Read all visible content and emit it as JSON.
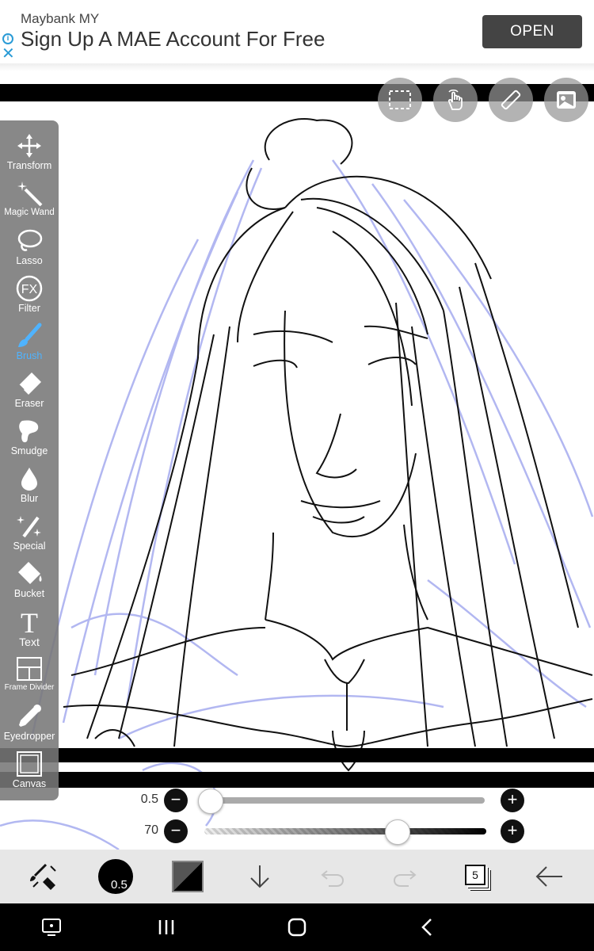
{
  "ad": {
    "sponsor": "Maybank MY",
    "title": "Sign Up A MAE Account For Free",
    "cta": "OPEN",
    "info_icon": "info-icon",
    "close_icon": "close-icon"
  },
  "canvas_tools": [
    {
      "name": "selection-icon"
    },
    {
      "name": "touch-icon"
    },
    {
      "name": "ruler-icon"
    },
    {
      "name": "material-icon"
    }
  ],
  "tools": [
    {
      "id": "transform",
      "label": "Transform",
      "icon": "move-icon"
    },
    {
      "id": "magic-wand",
      "label": "Magic Wand",
      "icon": "magic-wand-icon"
    },
    {
      "id": "lasso",
      "label": "Lasso",
      "icon": "lasso-icon"
    },
    {
      "id": "filter",
      "label": "Filter",
      "icon": "fx-icon"
    },
    {
      "id": "brush",
      "label": "Brush",
      "icon": "brush-icon"
    },
    {
      "id": "eraser",
      "label": "Eraser",
      "icon": "eraser-icon"
    },
    {
      "id": "smudge",
      "label": "Smudge",
      "icon": "smudge-icon"
    },
    {
      "id": "blur",
      "label": "Blur",
      "icon": "drop-icon"
    },
    {
      "id": "special",
      "label": "Special",
      "icon": "sparkle-icon"
    },
    {
      "id": "bucket",
      "label": "Bucket",
      "icon": "bucket-icon"
    },
    {
      "id": "text",
      "label": "Text",
      "icon": "text-icon"
    },
    {
      "id": "frame-divider",
      "label": "Frame Divider",
      "icon": "frame-divider-icon"
    },
    {
      "id": "eyedropper",
      "label": "Eyedropper",
      "icon": "eyedropper-icon"
    },
    {
      "id": "canvas",
      "label": "Canvas",
      "icon": "canvas-icon"
    }
  ],
  "active_tool": "Brush",
  "accent_color": "#4fb3ff",
  "sliders": {
    "size": {
      "value_label": "0.5",
      "minus": "−",
      "plus": "+"
    },
    "opacity": {
      "value_label": "70",
      "minus": "−",
      "plus": "+"
    }
  },
  "bottom_bar": {
    "brush_size": "0.5",
    "layer_count": "5"
  }
}
